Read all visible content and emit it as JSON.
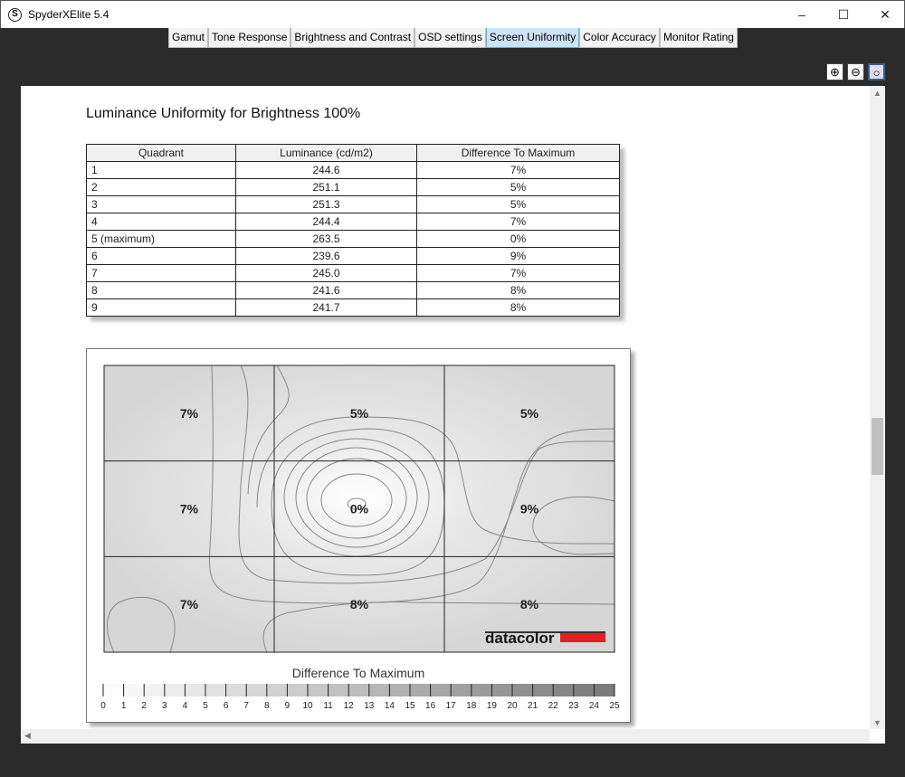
{
  "window": {
    "title": "SpyderXElite 5.4",
    "icon": "S",
    "minimize": "–",
    "maximize": "☐",
    "close": "✕"
  },
  "tabs": [
    {
      "label": "Gamut"
    },
    {
      "label": "Tone Response"
    },
    {
      "label": "Brightness and Contrast"
    },
    {
      "label": "OSD settings"
    },
    {
      "label": "Screen Uniformity",
      "active": true
    },
    {
      "label": "Color Accuracy"
    },
    {
      "label": "Monitor Rating"
    }
  ],
  "zoom_buttons": [
    {
      "icon": "zoom-in-icon"
    },
    {
      "icon": "zoom-out-icon"
    },
    {
      "icon": "zoom-fit-icon"
    }
  ],
  "report": {
    "title": "Luminance Uniformity for Brightness 100%",
    "table": {
      "headers": [
        "Quadrant",
        "Luminance (cd/m2)",
        "Difference To Maximum"
      ],
      "rows": [
        [
          "1",
          "244.6",
          "7%"
        ],
        [
          "2",
          "251.1",
          "5%"
        ],
        [
          "3",
          "251.3",
          "5%"
        ],
        [
          "4",
          "244.4",
          "7%"
        ],
        [
          "5 (maximum)",
          "263.5",
          "0%"
        ],
        [
          "6",
          "239.6",
          "9%"
        ],
        [
          "7",
          "245.0",
          "7%"
        ],
        [
          "8",
          "241.6",
          "8%"
        ],
        [
          "9",
          "241.7",
          "8%"
        ]
      ]
    },
    "heatmap": {
      "cells": [
        "7%",
        "5%",
        "5%",
        "7%",
        "0%",
        "9%",
        "7%",
        "8%",
        "8%"
      ],
      "logo": "datacolor",
      "logo_color": "#e31e24"
    },
    "legend": {
      "title": "Difference To Maximum",
      "min": 0,
      "max": 25,
      "labels": [
        "0",
        "1",
        "2",
        "3",
        "4",
        "5",
        "6",
        "7",
        "8",
        "9",
        "10",
        "11",
        "12",
        "13",
        "14",
        "15",
        "16",
        "17",
        "18",
        "19",
        "20",
        "21",
        "22",
        "23",
        "24",
        "25"
      ]
    }
  }
}
